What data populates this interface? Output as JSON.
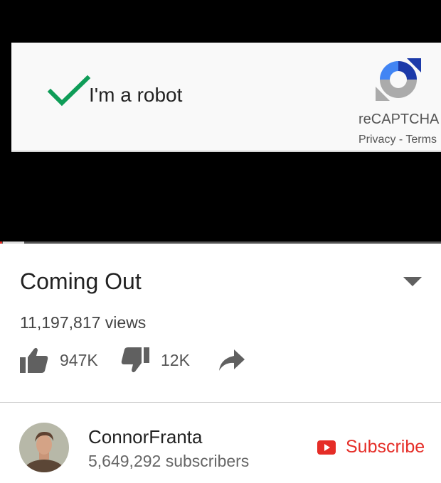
{
  "captcha": {
    "label": "I'm a robot",
    "brand": "reCAPTCHA",
    "privacy": "Privacy",
    "separator": " - ",
    "terms": "Terms"
  },
  "video": {
    "progress_fraction": 0.005,
    "title": "Coming Out",
    "views": "11,197,817 views",
    "likes": "947K",
    "dislikes": "12K"
  },
  "channel": {
    "name": "ConnorFranta",
    "subscribers": "5,649,292 subscribers",
    "subscribe_label": "Subscribe"
  },
  "colors": {
    "check_green": "#0f9d58",
    "youtube_red": "#e52d27",
    "recaptcha_blue": "#4285f4"
  },
  "icons": [
    "check-icon",
    "recaptcha-logo-icon",
    "chevron-down-icon",
    "thumbs-up-icon",
    "thumbs-down-icon",
    "share-icon",
    "youtube-play-icon"
  ]
}
